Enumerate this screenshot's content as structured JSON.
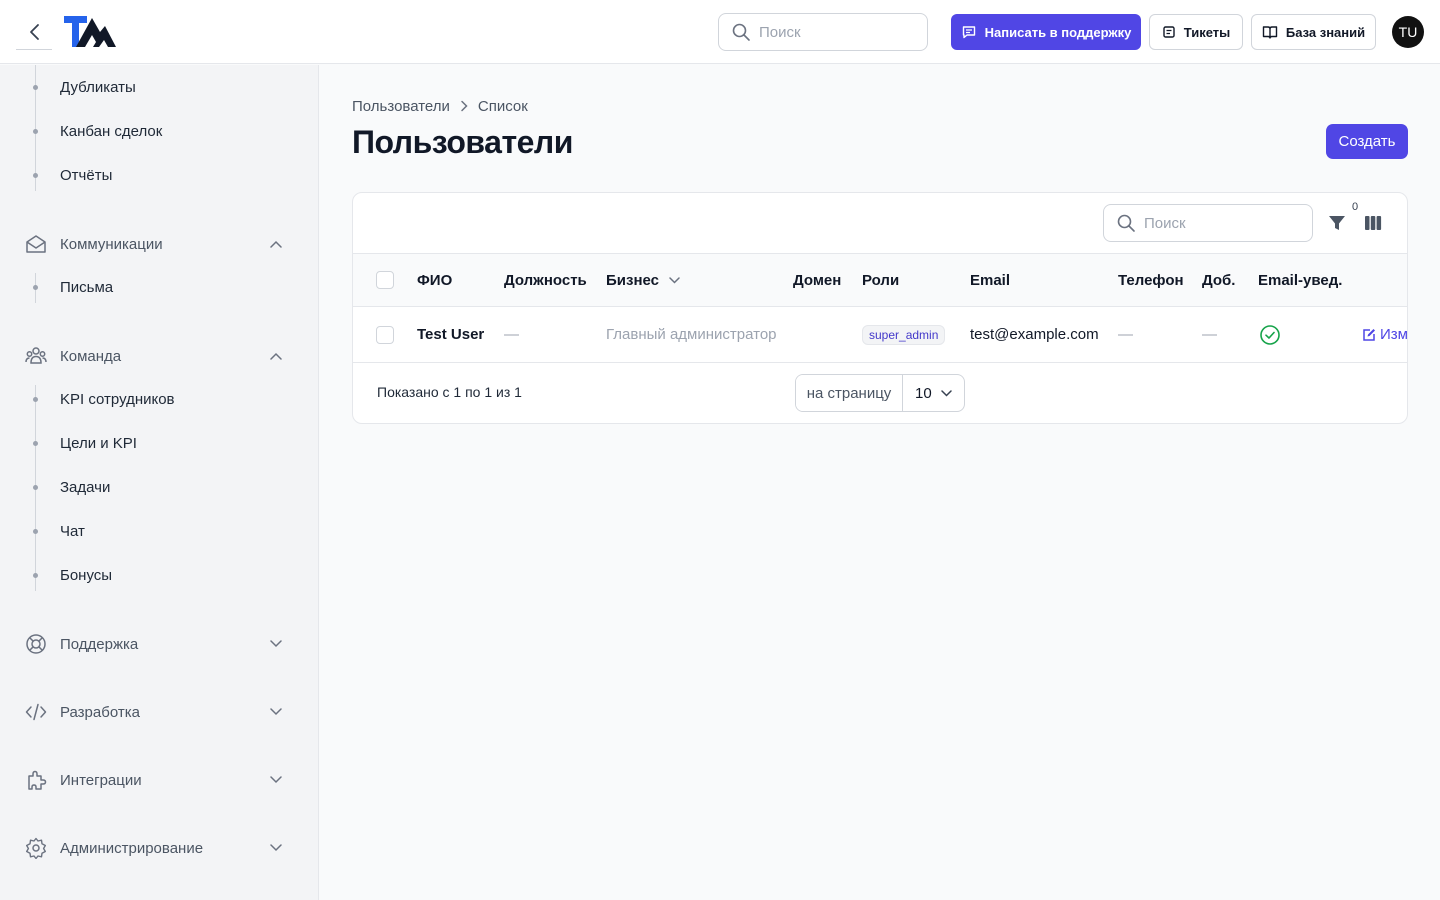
{
  "topbar": {
    "search_placeholder": "Поиск",
    "support_label": "Написать в поддержку",
    "tickets_label": "Тикеты",
    "kb_label": "База знаний",
    "avatar_initials": "TU"
  },
  "sidebar": {
    "top_items": [
      "Дубликаты",
      "Канбан сделок",
      "Отчёты"
    ],
    "groups": [
      {
        "label": "Коммуникации",
        "icon": "mail-open-icon",
        "expanded": true,
        "items": [
          "Письма"
        ]
      },
      {
        "label": "Команда",
        "icon": "team-icon",
        "expanded": true,
        "items": [
          "KPI сотрудников",
          "Цели и KPI",
          "Задачи",
          "Чат",
          "Бонусы"
        ]
      },
      {
        "label": "Поддержка",
        "icon": "lifebuoy-icon",
        "expanded": false
      },
      {
        "label": "Разработка",
        "icon": "code-icon",
        "expanded": false
      },
      {
        "label": "Интеграции",
        "icon": "puzzle-icon",
        "expanded": false
      },
      {
        "label": "Администрирование",
        "icon": "gear-icon",
        "expanded": false
      }
    ]
  },
  "breadcrumb": {
    "first": "Пользователи",
    "second": "Список"
  },
  "page": {
    "title": "Пользователи",
    "create_label": "Создать"
  },
  "table": {
    "search_placeholder": "Поиск",
    "filter_count": "0",
    "columns": [
      "ФИО",
      "Должность",
      "Бизнес",
      "Домен",
      "Роли",
      "Email",
      "Телефон",
      "Доб.",
      "Email-увед."
    ],
    "rows": [
      {
        "name": "Test User",
        "position": "—",
        "business": "Главный администратор",
        "domain": "",
        "role": "super_admin",
        "email": "test@example.com",
        "phone": "—",
        "ext": "—",
        "email_notify": true,
        "edit_label": "Изм"
      }
    ],
    "shown_text": "Показано с 1 по 1 из 1",
    "perpage_label": "на страницу",
    "perpage_value": "10"
  },
  "colors": {
    "accent": "#5046e5",
    "success": "#16a34a"
  }
}
